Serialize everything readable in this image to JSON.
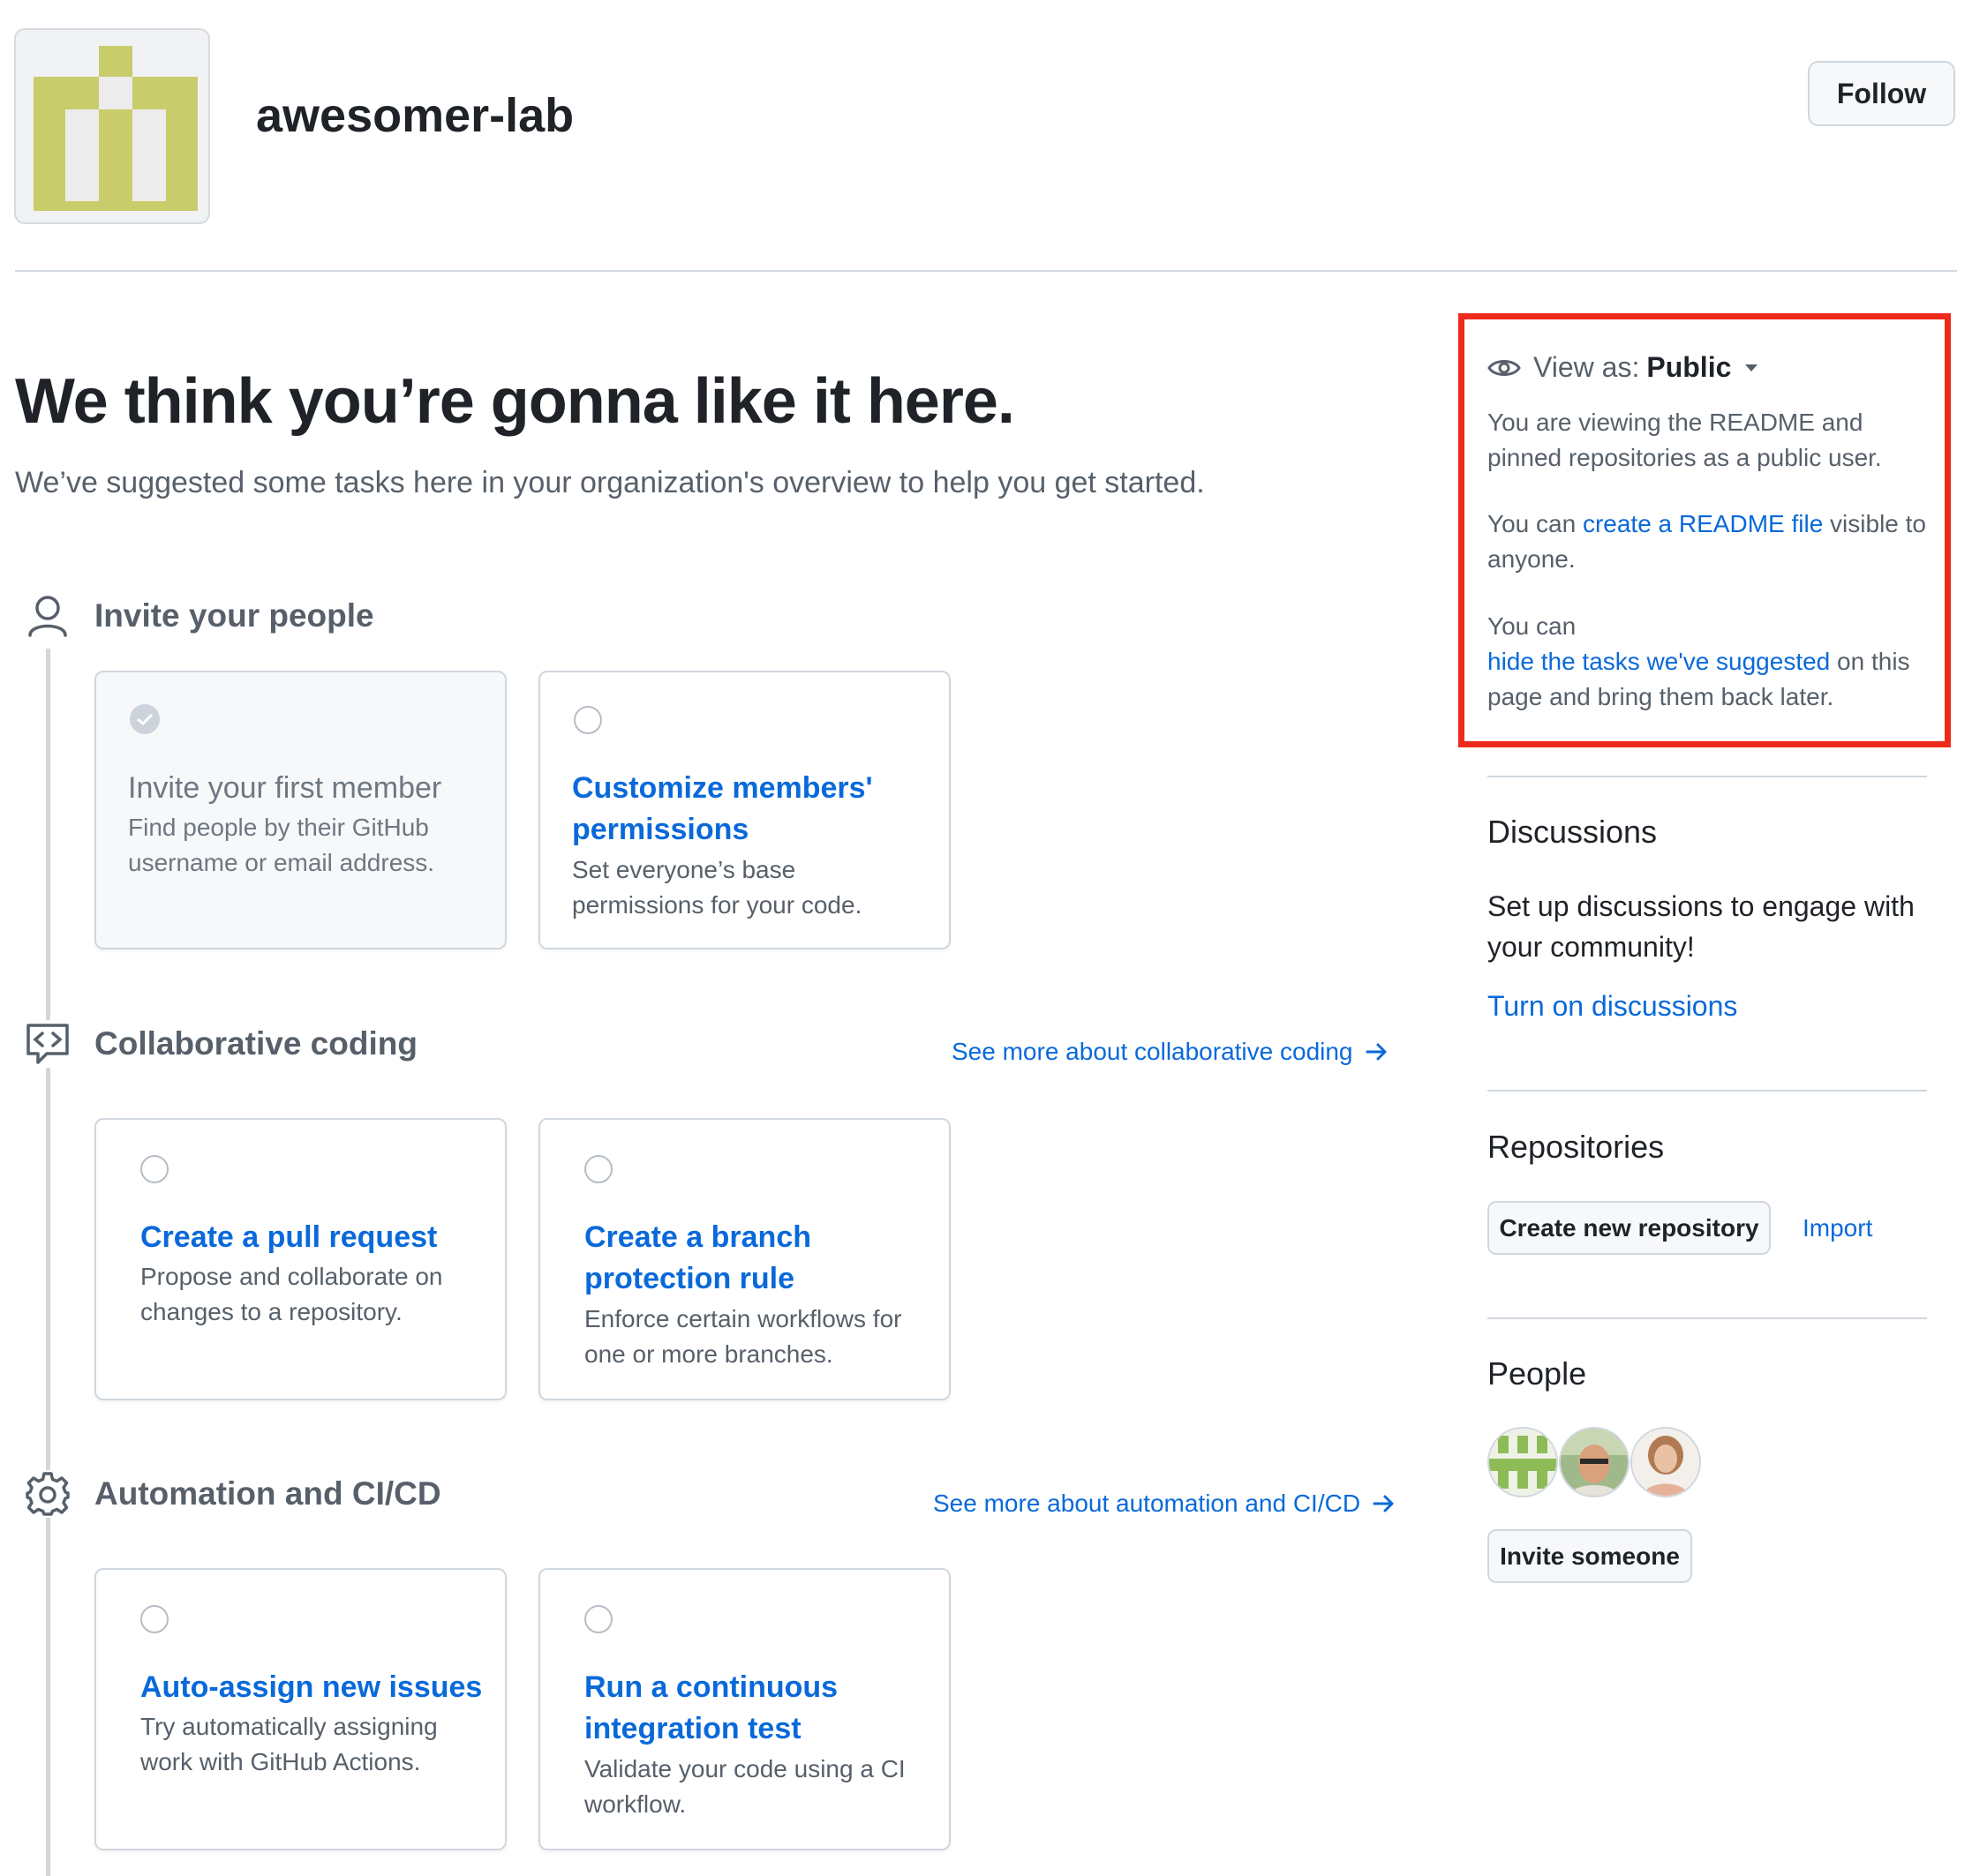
{
  "org": {
    "name": "awesomer-lab",
    "follow_label": "Follow"
  },
  "hero": {
    "title": "We think you’re gonna like it here.",
    "subtitle": "We’ve suggested some tasks here in your organization's overview to help you get started."
  },
  "sections": [
    {
      "title": "Invite your people",
      "icon": "person-icon",
      "cards": [
        {
          "title": "Invite your first member",
          "desc1": "Find people by their GitHub",
          "desc2": "username or email address.",
          "completed": true
        },
        {
          "title1": "Customize members'",
          "title2": "permissions",
          "desc1": "Set everyone’s base",
          "desc2": "permissions for your code.",
          "completed": false
        }
      ]
    },
    {
      "title": "Collaborative coding",
      "icon": "code-review-icon",
      "see_more": "See more about collaborative coding",
      "cards": [
        {
          "title1": "Create a pull request",
          "desc1": "Propose and collaborate on",
          "desc2": "changes to a repository.",
          "completed": false
        },
        {
          "title1": "Create a branch",
          "title2": "protection rule",
          "desc1": "Enforce certain workflows for",
          "desc2": "one or more branches.",
          "completed": false
        }
      ]
    },
    {
      "title": "Automation and CI/CD",
      "icon": "gear-icon",
      "see_more": "See more about automation and CI/CD",
      "cards": [
        {
          "title1": "Auto-assign new issues",
          "desc1": "Try automatically assigning",
          "desc2": "work with GitHub Actions.",
          "completed": false
        },
        {
          "title1": "Run a continuous",
          "title2": "integration test",
          "desc1": "Validate your code using a CI",
          "desc2": "workflow.",
          "completed": false
        }
      ]
    }
  ],
  "sidebar": {
    "view_as_label": "View as:",
    "view_as_value": "Public",
    "viewing_1": "You are viewing the README and",
    "viewing_2": "pinned repositories as a public user.",
    "readme_prefix": "You can ",
    "readme_link": "create a README file",
    "readme_suffix": " visible to",
    "readme_line2": "anyone.",
    "hide_prefix": "You can",
    "hide_link": "hide the tasks we've suggested",
    "hide_suffix": " on this",
    "hide_line3": "page and bring them back later.",
    "discussions": {
      "heading": "Discussions",
      "text1": "Set up discussions to engage with",
      "text2": "your community!",
      "link": "Turn on discussions"
    },
    "repositories": {
      "heading": "Repositories",
      "create_label": "Create new repository",
      "import_label": "Import"
    },
    "people": {
      "heading": "People",
      "invite_label": "Invite someone"
    }
  },
  "colors": {
    "link": "#0969da",
    "highlight_border": "#ee2a1b",
    "org_avatar": "#c9cc6a"
  }
}
